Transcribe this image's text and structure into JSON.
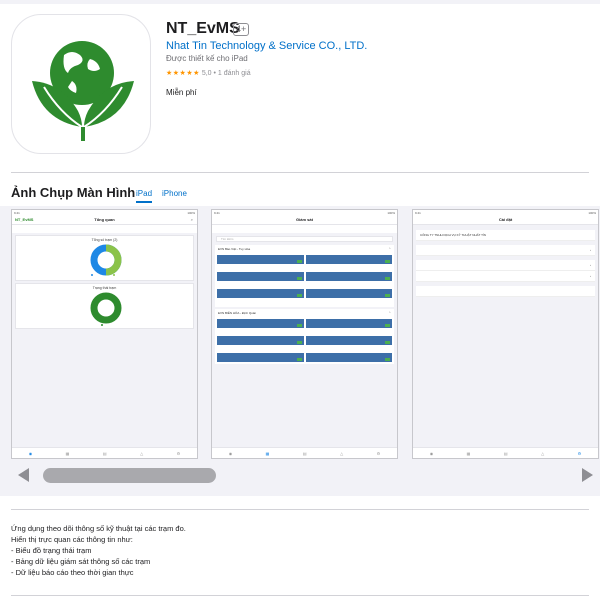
{
  "app": {
    "title": "NT_EvMS",
    "age_rating": "4+",
    "developer": "Nhat Tin Technology & Service CO., LTD.",
    "designed_for": "Được thiết kế cho iPad",
    "stars": "★★★★★",
    "rating": "5,0 • 1 đánh giá",
    "price": "Miễn phí"
  },
  "screenshots": {
    "title": "Ảnh Chụp Màn Hình",
    "tabs": [
      "iPad",
      "iPhone"
    ],
    "active_tab": "iPad"
  },
  "shot1": {
    "app_logo": "NT_EvMS",
    "nav_title": "Tổng quan",
    "card1_title": "Tổng số trạm (2)",
    "card2_title": "Trạng thái trạm"
  },
  "shot2": {
    "nav_title": "Giám sát",
    "search_placeholder": "Tìm kiếm",
    "group1": "EVN Bảo Việt - Tuy Hòa",
    "group2": "EVN BIÊN HÒA - Định Quán"
  },
  "shot3": {
    "nav_title": "Cài đặt",
    "company": "CÔNG TY TNHH DỊCH VỤ KỸ THUẬT NHẤT TÍN"
  },
  "description": {
    "lines": [
      "Ứng dụng theo dõi thông số kỹ thuật tại các trạm đo.",
      "Hiển thị trực quan các thông tin như:",
      "- Biểu đồ trạng thái trạm",
      "- Bảng dữ liệu giám sát thông số các trạm",
      "- Dữ liệu báo cáo theo thời gian thực"
    ]
  },
  "colors": {
    "link": "#0070c9",
    "brand_green": "#2e8b2e",
    "cell_blue": "#3d6fa8",
    "chart_blue": "#1e88e5",
    "chart_green": "#8bc34a"
  }
}
